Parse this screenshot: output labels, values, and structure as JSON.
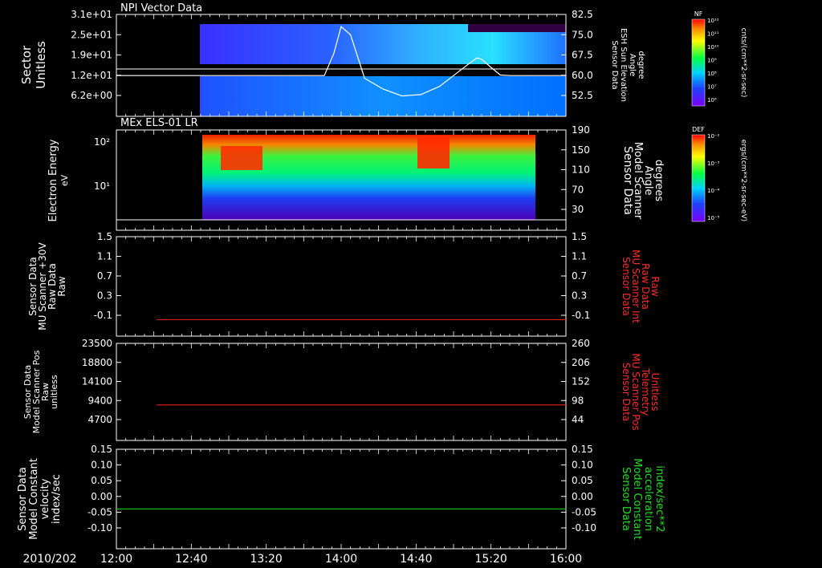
{
  "date_label": "2010/202",
  "time_ticks": [
    "12:00",
    "12:40",
    "13:20",
    "14:00",
    "14:40",
    "15:20",
    "16:00"
  ],
  "colors": {
    "axis": "#ffffff",
    "red_trace": "#ff2020",
    "green_trace": "#20e020",
    "red_label": "#ff2a2a",
    "green_label": "#22dd22"
  },
  "chart_data": [
    {
      "type": "heatmap",
      "title": "NPI Vector Data",
      "ylabel": [
        "Sector",
        "Unitless"
      ],
      "ytick_labels": [
        "3.1e+01",
        "2.5e+01",
        "1.9e+01",
        "1.2e+01",
        "6.2e+00"
      ],
      "right_label": [
        "Sensor Data",
        "ESH Sun Elevation",
        "Angle",
        "degree"
      ],
      "right_ticks": [
        "82.5",
        "75.0",
        "67.5",
        "60.0",
        "52.5"
      ],
      "overlay_line": {
        "description": "Sensor Data ESH Sun Elevation Angle",
        "x_minutes": [
          0,
          222,
          232,
          240,
          250,
          265,
          285,
          305,
          325,
          345,
          360,
          375,
          385,
          390,
          400,
          410,
          420,
          430,
          445,
          460,
          480
        ],
        "y_degree": [
          60.0,
          60.0,
          68,
          78,
          75,
          59,
          55,
          52.5,
          53,
          56,
          60,
          64,
          66.5,
          66,
          63,
          60.2,
          60,
          60,
          60,
          60,
          60
        ]
      },
      "colorbar": {
        "label": "NF",
        "title": "cnts/(cm**2-sr-sec)",
        "tick_labels": [
          "10¹²",
          "10¹¹",
          "10¹⁰",
          "10⁹",
          "10⁸",
          "10⁷",
          "10⁶"
        ]
      }
    },
    {
      "type": "heatmap",
      "title": "MEx ELS-01 LR",
      "ylabel": [
        "Electron Energy",
        "eV"
      ],
      "ytick_labels": [
        "10²",
        "10¹"
      ],
      "right_label": [
        "Sensor Data",
        "Model Scanner",
        "Angle",
        "degrees"
      ],
      "right_ticks": [
        "190",
        "150",
        "110",
        "70",
        "30"
      ],
      "colorbar": {
        "label": "DEF",
        "title": "ergs/(cm**2-sr-sec-eV)",
        "tick_labels": [
          "10⁻²",
          "10⁻³",
          "10⁻⁴",
          "10⁻⁵"
        ]
      }
    },
    {
      "type": "line",
      "ylabel": [
        "Sensor Data",
        "MU Scanner +30V",
        "Raw Data",
        "Raw"
      ],
      "yticks": [
        "1.5",
        "1.1",
        "0.7",
        "0.3",
        "-0.1"
      ],
      "ylim": [
        -0.3,
        1.5
      ],
      "right_label": [
        "Sensor Data",
        "MU Scanner Int",
        "Raw Data",
        "Raw"
      ],
      "right_ticks": [
        "1.5",
        "1.1",
        "0.7",
        "0.3",
        "-0.1"
      ],
      "series": [
        {
          "x_minutes": [
            43,
            480
          ],
          "values": [
            0.0,
            0.0
          ]
        }
      ]
    },
    {
      "type": "line",
      "ylabel": [
        "Sensor Data",
        "Model Scanner Pos",
        "Raw",
        "unitless"
      ],
      "yticks": [
        "23500",
        "18800",
        "14100",
        "9400",
        "4700"
      ],
      "ylim": [
        0,
        23500
      ],
      "right_label": [
        "Sensor Data",
        "MU Scanner Pos",
        "Telemetry",
        "Unitless"
      ],
      "right_ticks": [
        "260",
        "206",
        "152",
        "98",
        "44"
      ],
      "series": [
        {
          "x_minutes": [
            43,
            480
          ],
          "values": [
            8600,
            8600
          ]
        }
      ]
    },
    {
      "type": "line",
      "ylabel": [
        "Sensor Data",
        "Model Constant",
        "velocity",
        "index/sec"
      ],
      "yticks": [
        "0.15",
        "0.10",
        "0.05",
        "0.00",
        "-0.05",
        "-0.10"
      ],
      "ylim": [
        -0.1,
        0.15
      ],
      "right_label": [
        "Sensor Data",
        "Model Constant",
        "acceleration",
        "index/sec**2"
      ],
      "right_ticks": [
        "0.15",
        "0.10",
        "0.05",
        "0.00",
        "-0.05",
        "-0.10"
      ],
      "series": [
        {
          "x_minutes": [
            0,
            480
          ],
          "values": [
            0.0,
            0.0
          ]
        }
      ]
    }
  ]
}
